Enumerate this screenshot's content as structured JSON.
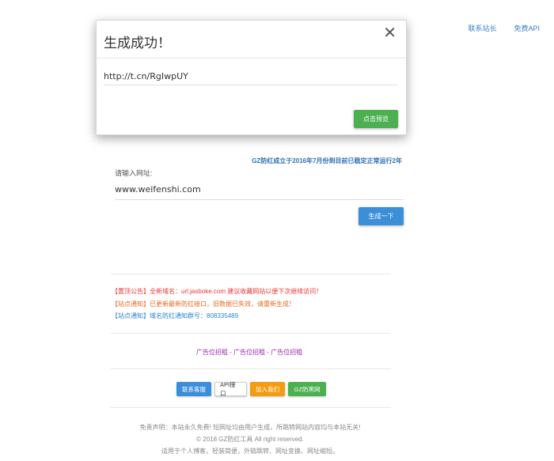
{
  "top_links": {
    "contact": "联系站长",
    "api": "免费API"
  },
  "modal": {
    "title": "生成成功！",
    "close": "✕",
    "url": "http://t.cn/RgIwpUY",
    "preview_button": "点击预览"
  },
  "notice_top": "GZ防红成立于2016年7月份到目前已稳定正常运行2年",
  "form": {
    "label": "请输入网址:",
    "input_value": "www.weifenshi.com",
    "generate_button": "生成一下"
  },
  "announcements": {
    "a1_tag": "【置顶公告】",
    "a1_text": "全新域名：url.jasboke.com 建议收藏网站以便下次继续访问！",
    "a2_tag": "【站点通知】",
    "a2_text": "已更新最新防红接口，旧数据已失效，请重新生成！",
    "a3_tag": "【站点通知】",
    "a3_text": "域名防红通知群号：808335489"
  },
  "ads": "广告位招租 - 广告位招租 - 广告位招租",
  "buttons": {
    "service": "联系客服",
    "api": "API接口",
    "join": "加入我们",
    "gz": "GZ防黑网",
    "colors": {
      "service": "#3b8ed8",
      "api": "#ffffff",
      "join": "#f39c12",
      "gz": "#4caf50"
    }
  },
  "footer": {
    "line1": "免责声明：本站永久免费! 短网址均由用户生成，所跳转网站内容均与本站无关!",
    "line2": "© 2018 GZ防红工具 All right reserved.",
    "line3": "适用于个人博客，轻装简便，外链跳转、网址变换、网址缩短。"
  }
}
